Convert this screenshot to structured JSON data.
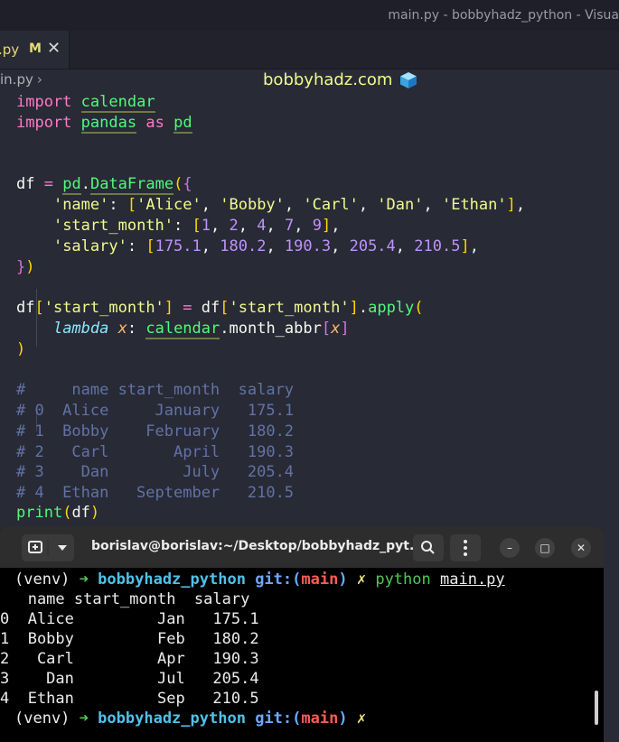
{
  "window": {
    "title": "main.py - bobbyhadz_python - Visua"
  },
  "tab": {
    "label": ".py",
    "modified": "M",
    "close": "✕"
  },
  "header": {
    "site": "bobbyhadz.com"
  },
  "breadcrumb": {
    "file": "in.py",
    "chevron": "›"
  },
  "code": {
    "import1_kw": "import",
    "import1_mod": "calendar",
    "import2_kw": "import",
    "import2_mod": "pandas",
    "import2_as": "as",
    "import2_alias": "pd",
    "df": "df",
    "eq": "=",
    "pd": "pd",
    "DataFrame": "DataFrame",
    "name_key": "'name'",
    "names": [
      "'Alice'",
      "'Bobby'",
      "'Carl'",
      "'Dan'",
      "'Ethan'"
    ],
    "start_key": "'start_month'",
    "start_vals": [
      "1",
      "2",
      "4",
      "7",
      "9"
    ],
    "salary_key": "'salary'",
    "salary_vals": [
      "175.1",
      "180.2",
      "190.3",
      "205.4",
      "210.5"
    ],
    "apply": "apply",
    "lambda": "lambda",
    "x": "x",
    "calendar": "calendar",
    "month_abbr": "month_abbr",
    "comments": [
      "#     name start_month  salary",
      "# 0  Alice     January   175.1",
      "# 1  Bobby    February   180.2",
      "# 2   Carl       April   190.3",
      "# 3    Dan        July   205.4",
      "# 4  Ethan   September   210.5"
    ],
    "print": "print"
  },
  "terminal": {
    "title": "borislav@borislav:~/Desktop/bobbyhadz_pyt...",
    "prompt_venv": "(venv)",
    "prompt_arrow": "➜",
    "prompt_dir": "bobbyhadz_python",
    "prompt_git": "git:(",
    "prompt_branch": "main",
    "prompt_git_close": ")",
    "prompt_x": "✗",
    "cmd": "python",
    "cmd_arg": "main.py",
    "output": [
      "   name start_month  salary",
      "0  Alice         Jan   175.1",
      "1  Bobby         Feb   180.2",
      "2   Carl         Apr   190.3",
      "3    Dan         Jul   205.4",
      "4  Ethan         Sep   210.5"
    ],
    "buttons": {
      "min": "–",
      "max": "□",
      "close": "✕"
    }
  }
}
